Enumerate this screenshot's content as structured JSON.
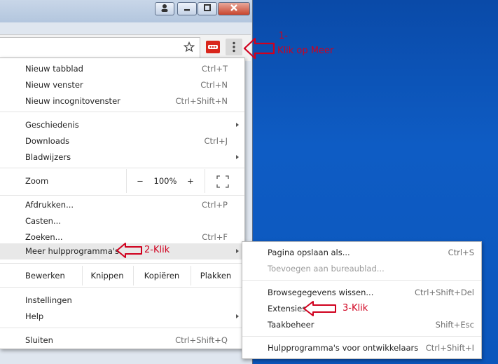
{
  "annotations": {
    "step1_number": "1-",
    "step1_text": "Klik op Meer",
    "step2_text": "2-Klik",
    "step3_text": "3-Klik",
    "color": "#d0001e"
  },
  "menu": {
    "items": {
      "new_tab": {
        "label": "Nieuw tabblad",
        "shortcut": "Ctrl+T"
      },
      "new_window": {
        "label": "Nieuw venster",
        "shortcut": "Ctrl+N"
      },
      "new_incognito": {
        "label": "Nieuw incognitovenster",
        "shortcut": "Ctrl+Shift+N"
      },
      "history": {
        "label": "Geschiedenis"
      },
      "downloads": {
        "label": "Downloads",
        "shortcut": "Ctrl+J"
      },
      "bookmarks": {
        "label": "Bladwijzers"
      },
      "zoom": {
        "label": "Zoom",
        "minus": "−",
        "value": "100%",
        "plus": "+"
      },
      "print": {
        "label": "Afdrukken...",
        "shortcut": "Ctrl+P"
      },
      "cast": {
        "label": "Casten..."
      },
      "find": {
        "label": "Zoeken...",
        "shortcut": "Ctrl+F"
      },
      "more_tools": {
        "label": "Meer hulpprogramma's"
      },
      "edit": {
        "label": "Bewerken",
        "cut": "Knippen",
        "copy": "Kopiëren",
        "paste": "Plakken"
      },
      "settings": {
        "label": "Instellingen"
      },
      "help": {
        "label": "Help"
      },
      "exit": {
        "label": "Sluiten",
        "shortcut": "Ctrl+Shift+Q"
      }
    }
  },
  "submenu": {
    "items": {
      "save_page": {
        "label": "Pagina opslaan als...",
        "shortcut": "Ctrl+S"
      },
      "add_to_desktop": {
        "label": "Toevoegen aan bureaublad..."
      },
      "clear_data": {
        "label": "Browsegegevens wissen...",
        "shortcut": "Ctrl+Shift+Del"
      },
      "extensions": {
        "label": "Extensies"
      },
      "task_manager": {
        "label": "Taakbeheer",
        "shortcut": "Shift+Esc"
      },
      "dev_tools": {
        "label": "Hulpprogramma's voor ontwikkelaars",
        "shortcut": "Ctrl+Shift+I"
      }
    }
  },
  "icons": [
    "user-icon",
    "minimize-icon",
    "maximize-icon",
    "close-icon",
    "star-icon",
    "extension-badge-icon",
    "more-icon",
    "fullscreen-icon",
    "submenu-arrow-icon",
    "red-arrow-icon"
  ]
}
